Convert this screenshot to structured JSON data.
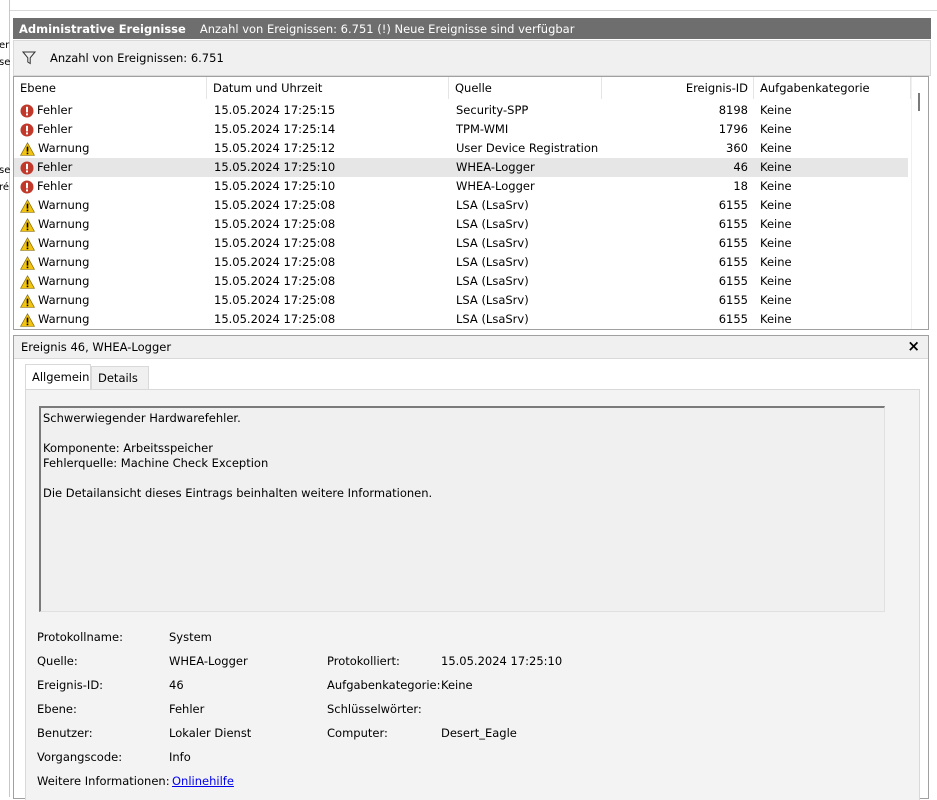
{
  "left_fragments": [
    "er",
    "se",
    "se",
    "ré"
  ],
  "titlebar": {
    "title": "Administrative Ereignisse",
    "info": "Anzahl von Ereignissen: 6.751 (!) Neue Ereignisse sind verfügbar"
  },
  "filterbar": {
    "text": "Anzahl von Ereignissen: 6.751"
  },
  "columns": [
    "Ebene",
    "Datum und Uhrzeit",
    "Quelle",
    "Ereignis-ID",
    "Aufgabenkategorie"
  ],
  "events": [
    {
      "level": "Fehler",
      "type": "error",
      "datetime": "15.05.2024 17:25:15",
      "source": "Security-SPP",
      "id": "8198",
      "category": "Keine"
    },
    {
      "level": "Fehler",
      "type": "error",
      "datetime": "15.05.2024 17:25:14",
      "source": "TPM-WMI",
      "id": "1796",
      "category": "Keine"
    },
    {
      "level": "Warnung",
      "type": "warning",
      "datetime": "15.05.2024 17:25:12",
      "source": "User Device Registration",
      "id": "360",
      "category": "Keine"
    },
    {
      "level": "Fehler",
      "type": "error",
      "datetime": "15.05.2024 17:25:10",
      "source": "WHEA-Logger",
      "id": "46",
      "category": "Keine",
      "selected": true
    },
    {
      "level": "Fehler",
      "type": "error",
      "datetime": "15.05.2024 17:25:10",
      "source": "WHEA-Logger",
      "id": "18",
      "category": "Keine"
    },
    {
      "level": "Warnung",
      "type": "warning",
      "datetime": "15.05.2024 17:25:08",
      "source": "LSA (LsaSrv)",
      "id": "6155",
      "category": "Keine"
    },
    {
      "level": "Warnung",
      "type": "warning",
      "datetime": "15.05.2024 17:25:08",
      "source": "LSA (LsaSrv)",
      "id": "6155",
      "category": "Keine"
    },
    {
      "level": "Warnung",
      "type": "warning",
      "datetime": "15.05.2024 17:25:08",
      "source": "LSA (LsaSrv)",
      "id": "6155",
      "category": "Keine"
    },
    {
      "level": "Warnung",
      "type": "warning",
      "datetime": "15.05.2024 17:25:08",
      "source": "LSA (LsaSrv)",
      "id": "6155",
      "category": "Keine"
    },
    {
      "level": "Warnung",
      "type": "warning",
      "datetime": "15.05.2024 17:25:08",
      "source": "LSA (LsaSrv)",
      "id": "6155",
      "category": "Keine"
    },
    {
      "level": "Warnung",
      "type": "warning",
      "datetime": "15.05.2024 17:25:08",
      "source": "LSA (LsaSrv)",
      "id": "6155",
      "category": "Keine"
    },
    {
      "level": "Warnung",
      "type": "warning",
      "datetime": "15.05.2024 17:25:08",
      "source": "LSA (LsaSrv)",
      "id": "6155",
      "category": "Keine"
    }
  ],
  "detail": {
    "title": "Ereignis 46, WHEA-Logger",
    "close": "×",
    "tabs": [
      "Allgemein",
      "Details"
    ],
    "message": [
      "Schwerwiegender Hardwarefehler.",
      "",
      "Komponente: Arbeitsspeicher",
      "Fehlerquelle: Machine Check Exception",
      "",
      "Die Detailansicht dieses Eintrags beinhalten weitere Informationen."
    ],
    "props": {
      "protokollname_label": "Protokollname:",
      "protokollname": "System",
      "quelle_label": "Quelle:",
      "quelle": "WHEA-Logger",
      "protokolliert_label": "Protokolliert:",
      "protokolliert": "15.05.2024 17:25:10",
      "id_label": "Ereignis-ID:",
      "id": "46",
      "kategorie_label": "Aufgabenkategorie:",
      "kategorie": "Keine",
      "ebene_label": "Ebene:",
      "ebene": "Fehler",
      "schluessel_label": "Schlüsselwörter:",
      "schluessel": "",
      "benutzer_label": "Benutzer:",
      "benutzer": "Lokaler Dienst",
      "computer_label": "Computer:",
      "computer": "Desert_Eagle",
      "vorgang_label": "Vorgangscode:",
      "vorgang": "Info",
      "info_label": "Weitere Informationen:",
      "info_link": "Onlinehilfe"
    }
  },
  "colors": {
    "error": "#c0392b",
    "warning": "#f2c40f",
    "titlebar": "#6e6e6e",
    "selected_row": "#e6e6e6"
  }
}
